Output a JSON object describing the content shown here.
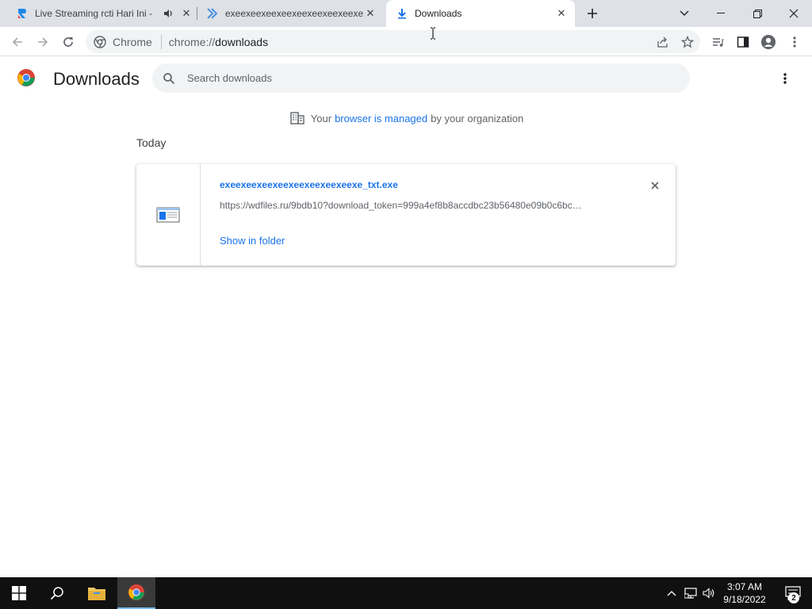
{
  "tabs": [
    {
      "title": "Live Streaming rcti Hari Ini - ",
      "icon": "rcti-favicon",
      "muted_icon": "speaker-icon"
    },
    {
      "title": "exeexeexeexeexeexeexeexeexeexe_txt",
      "icon": "double-chevron-favicon"
    },
    {
      "title": "Downloads",
      "icon": "download-icon"
    }
  ],
  "omnibox": {
    "chip_label": "Chrome",
    "url_scheme": "chrome://",
    "url_path": "downloads"
  },
  "page": {
    "title": "Downloads",
    "search_placeholder": "Search downloads",
    "managed_prefix": "Your",
    "managed_link": "browser is managed",
    "managed_suffix": "by your organization",
    "section_label": "Today"
  },
  "download": {
    "filename": "exeexeexeexeexeexeexeexeexe_txt.exe",
    "url": "https://wdfiles.ru/9bdb10?download_token=999a4ef8b8accdbc23b56480e09b0c6bc…",
    "action": "Show in folder"
  },
  "taskbar": {
    "time": "3:07 AM",
    "date": "9/18/2022",
    "notifications": "2"
  },
  "colors": {
    "accent": "#1a73e8",
    "tabstrip": "#dee1e6",
    "taskbar": "#101010"
  }
}
